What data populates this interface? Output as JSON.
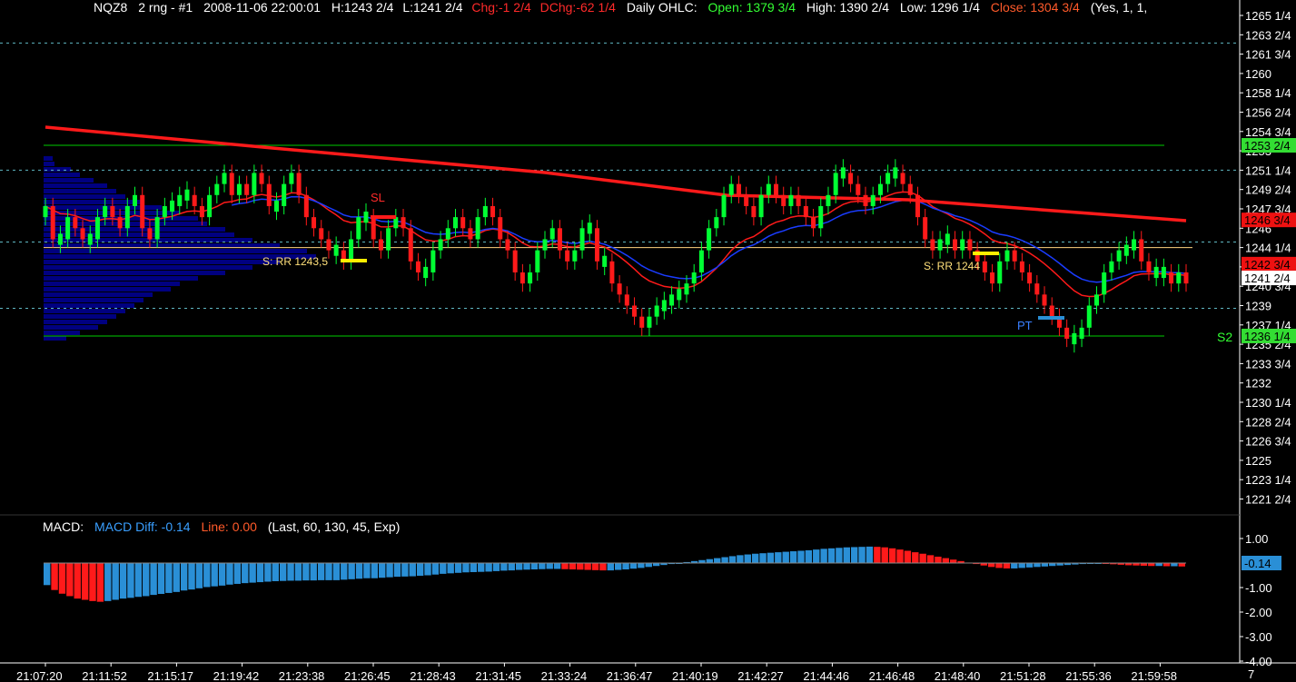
{
  "header": {
    "symbol": "NQZ8",
    "period": "2 rng - #1",
    "timestamp": "2008-11-06  22:00:01",
    "high": "H:1243 2/4",
    "low": "L:1241 2/4",
    "chg": "Chg:-1 2/4",
    "dchg": "DChg:-62 1/4",
    "daily_label": "Daily OHLC:",
    "open": "Open: 1379 3/4",
    "day_high": "High: 1390 2/4",
    "day_low": "Low: 1296 1/4",
    "close": "Close: 1304 3/4",
    "extra": "(Yes, 1, 1,"
  },
  "colors": {
    "background": "#000000",
    "up_candle": "#00ff33",
    "down_candle": "#ff1a1a",
    "slow_ma": "#ff1a1a",
    "fast_ma": "#ff1a1a",
    "mid_ma": "#1a3cff",
    "volume_profile": "#000080",
    "support_line": "#00cc00",
    "dashed_line": "#5fb7c2",
    "rr_line": "#ffd27f",
    "macd_up": "#2a8fd6",
    "macd_down": "#ff1a1a"
  },
  "price_axis": {
    "labels": [
      "1265 1/4",
      "1263 2/4",
      "1261 3/4",
      "1260",
      "1258 1/4",
      "1256 2/4",
      "1254 3/4",
      "1253",
      "1251 1/4",
      "1249 2/4",
      "1247 3/4",
      "1246",
      "1244 1/4",
      "1242 2/4",
      "1240 3/4",
      "1239",
      "1237 1/4",
      "1235 2/4",
      "1233 3/4",
      "1232",
      "1230 1/4",
      "1228 2/4",
      "1226 3/4",
      "1225",
      "1223 1/4",
      "1221 2/4"
    ],
    "tags": [
      {
        "text": "1253 2/4",
        "kind": "green"
      },
      {
        "text": "1246 3/4",
        "kind": "red"
      },
      {
        "text": "1242 3/4",
        "kind": "red"
      },
      {
        "text": "1241 2/4",
        "kind": "white"
      },
      {
        "text": "1236 1/4",
        "kind": "green"
      }
    ]
  },
  "time_axis": [
    "21:07:20",
    "21:11:52",
    "21:15:17",
    "21:19:42",
    "21:23:38",
    "21:26:45",
    "21:28:43",
    "21:31:45",
    "21:33:24",
    "21:36:47",
    "21:40:19",
    "21:42:27",
    "21:44:46",
    "21:46:48",
    "21:48:40",
    "21:51:28",
    "21:55:36",
    "21:59:58"
  ],
  "annotations": {
    "sl": "SL",
    "rr1": "S: RR 1243,5",
    "rr2": "S: RR 1244",
    "pt": "PT",
    "s2": "S2"
  },
  "macd": {
    "label": "MACD:",
    "diff": "MACD Diff: -0.14",
    "line": "Line: 0.00",
    "params": "(Last, 60, 130, 45, Exp)",
    "axis": [
      "1.00",
      "-1.00",
      "-2.00",
      "-3.00",
      "-4.00"
    ],
    "tag": "-0.14"
  },
  "footer_right": "7",
  "chart_data": {
    "type": "candlestick",
    "ylim": [
      1220,
      1266
    ],
    "levels": {
      "resistance_green": 1253.5,
      "support_green": 1236.25,
      "rr_level": 1244.25,
      "dashed": [
        1262.75,
        1251.25,
        1244.75,
        1238.75
      ]
    },
    "closes": [
      1248,
      1245,
      1245,
      1247,
      1246,
      1245,
      1245,
      1247,
      1248,
      1247,
      1246,
      1248,
      1249,
      1246,
      1245,
      1247,
      1248,
      1248,
      1249,
      1249,
      1248,
      1247,
      1249,
      1250,
      1251,
      1249,
      1250,
      1249,
      1251,
      1250,
      1248,
      1248,
      1250,
      1251,
      1249,
      1247,
      1246,
      1245,
      1244,
      1244,
      1243,
      1245,
      1247,
      1247,
      1245,
      1244,
      1246,
      1247,
      1246,
      1243,
      1242,
      1242,
      1244,
      1245,
      1246,
      1247,
      1246,
      1245,
      1247,
      1248,
      1247,
      1245,
      1244,
      1242,
      1241,
      1242,
      1244,
      1245,
      1246,
      1244,
      1243,
      1244,
      1246,
      1246,
      1243,
      1243,
      1241,
      1240,
      1239,
      1238,
      1237,
      1238,
      1239,
      1239,
      1240,
      1240,
      1241,
      1242,
      1244,
      1246,
      1247,
      1249,
      1250,
      1249,
      1248,
      1247,
      1249,
      1250,
      1249,
      1248,
      1249,
      1248,
      1247,
      1246,
      1248,
      1249,
      1251,
      1251,
      1250,
      1249,
      1248,
      1249,
      1250,
      1251,
      1251,
      1250,
      1249,
      1247,
      1245,
      1244,
      1245,
      1245,
      1244,
      1245,
      1244,
      1243,
      1242,
      1241,
      1243,
      1244,
      1243,
      1242,
      1241,
      1240,
      1239,
      1238,
      1237,
      1236,
      1236,
      1237,
      1239,
      1240,
      1242,
      1243,
      1244,
      1244,
      1245,
      1243,
      1242,
      1242,
      1242,
      1241,
      1242,
      1241
    ],
    "macd_hist": [
      -0.9,
      -1.1,
      -1.25,
      -1.35,
      -1.45,
      -1.5,
      -1.55,
      -1.58,
      -1.55,
      -1.5,
      -1.45,
      -1.42,
      -1.38,
      -1.35,
      -1.3,
      -1.26,
      -1.22,
      -1.18,
      -1.12,
      -1.08,
      -1.03,
      -0.98,
      -0.95,
      -0.92,
      -0.88,
      -0.85,
      -0.82,
      -0.8,
      -0.78,
      -0.76,
      -0.74,
      -0.73,
      -0.72,
      -0.72,
      -0.71,
      -0.71,
      -0.7,
      -0.7,
      -0.7,
      -0.68,
      -0.66,
      -0.64,
      -0.62,
      -0.62,
      -0.6,
      -0.58,
      -0.56,
      -0.55,
      -0.54,
      -0.52,
      -0.5,
      -0.47,
      -0.44,
      -0.42,
      -0.4,
      -0.38,
      -0.37,
      -0.36,
      -0.35,
      -0.33,
      -0.31,
      -0.3,
      -0.28,
      -0.27,
      -0.26,
      -0.25,
      -0.24,
      -0.24,
      -0.25,
      -0.26,
      -0.27,
      -0.28,
      -0.29,
      -0.3,
      -0.3,
      -0.28,
      -0.26,
      -0.23,
      -0.2,
      -0.16,
      -0.12,
      -0.08,
      -0.04,
      0.0,
      0.04,
      0.08,
      0.12,
      0.16,
      0.2,
      0.24,
      0.28,
      0.32,
      0.35,
      0.38,
      0.4,
      0.42,
      0.44,
      0.46,
      0.48,
      0.5,
      0.52,
      0.55,
      0.58,
      0.6,
      0.62,
      0.64,
      0.65,
      0.66,
      0.67,
      0.66,
      0.64,
      0.6,
      0.55,
      0.5,
      0.44,
      0.38,
      0.32,
      0.26,
      0.2,
      0.14,
      0.08,
      0.02,
      -0.04,
      -0.1,
      -0.16,
      -0.2,
      -0.22,
      -0.22,
      -0.2,
      -0.18,
      -0.16,
      -0.14,
      -0.12,
      -0.1,
      -0.08,
      -0.06,
      -0.04,
      -0.02,
      -0.02,
      -0.03,
      -0.05,
      -0.07,
      -0.09,
      -0.1,
      -0.11,
      -0.12,
      -0.12,
      -0.13,
      -0.13,
      -0.14
    ]
  }
}
